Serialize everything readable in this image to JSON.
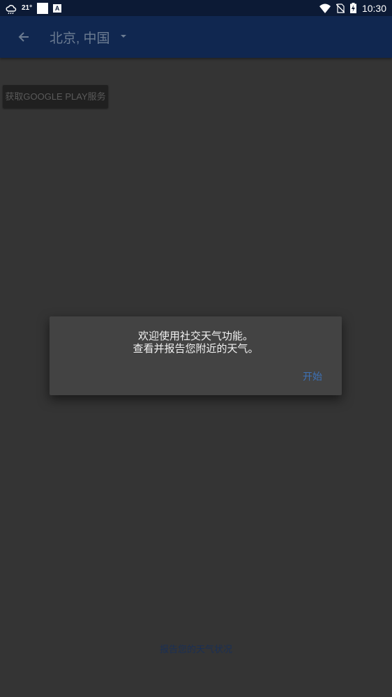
{
  "status_bar": {
    "temperature": "21°",
    "time": "10:30",
    "icons": [
      "weather-cloud-icon",
      "blank-square-icon",
      "a-badge-icon",
      "wifi-icon",
      "no-sim-icon",
      "battery-charging-icon"
    ]
  },
  "app_bar": {
    "back_icon": "arrow-left-icon",
    "location": "北京, 中国",
    "dropdown_icon": "caret-down-icon"
  },
  "main": {
    "google_play_button": "获取GOOGLE PLAY服务"
  },
  "dialog": {
    "line1": "欢迎使用社交天气功能。",
    "line2": "查看并报告您附近的天气。",
    "button": "开始"
  },
  "footer": {
    "report_link": "报告您的天气状况"
  },
  "colors": {
    "background": "#343434",
    "status_bar": "#0c1a35",
    "app_bar": "#102750",
    "accent": "#3e72b6"
  }
}
